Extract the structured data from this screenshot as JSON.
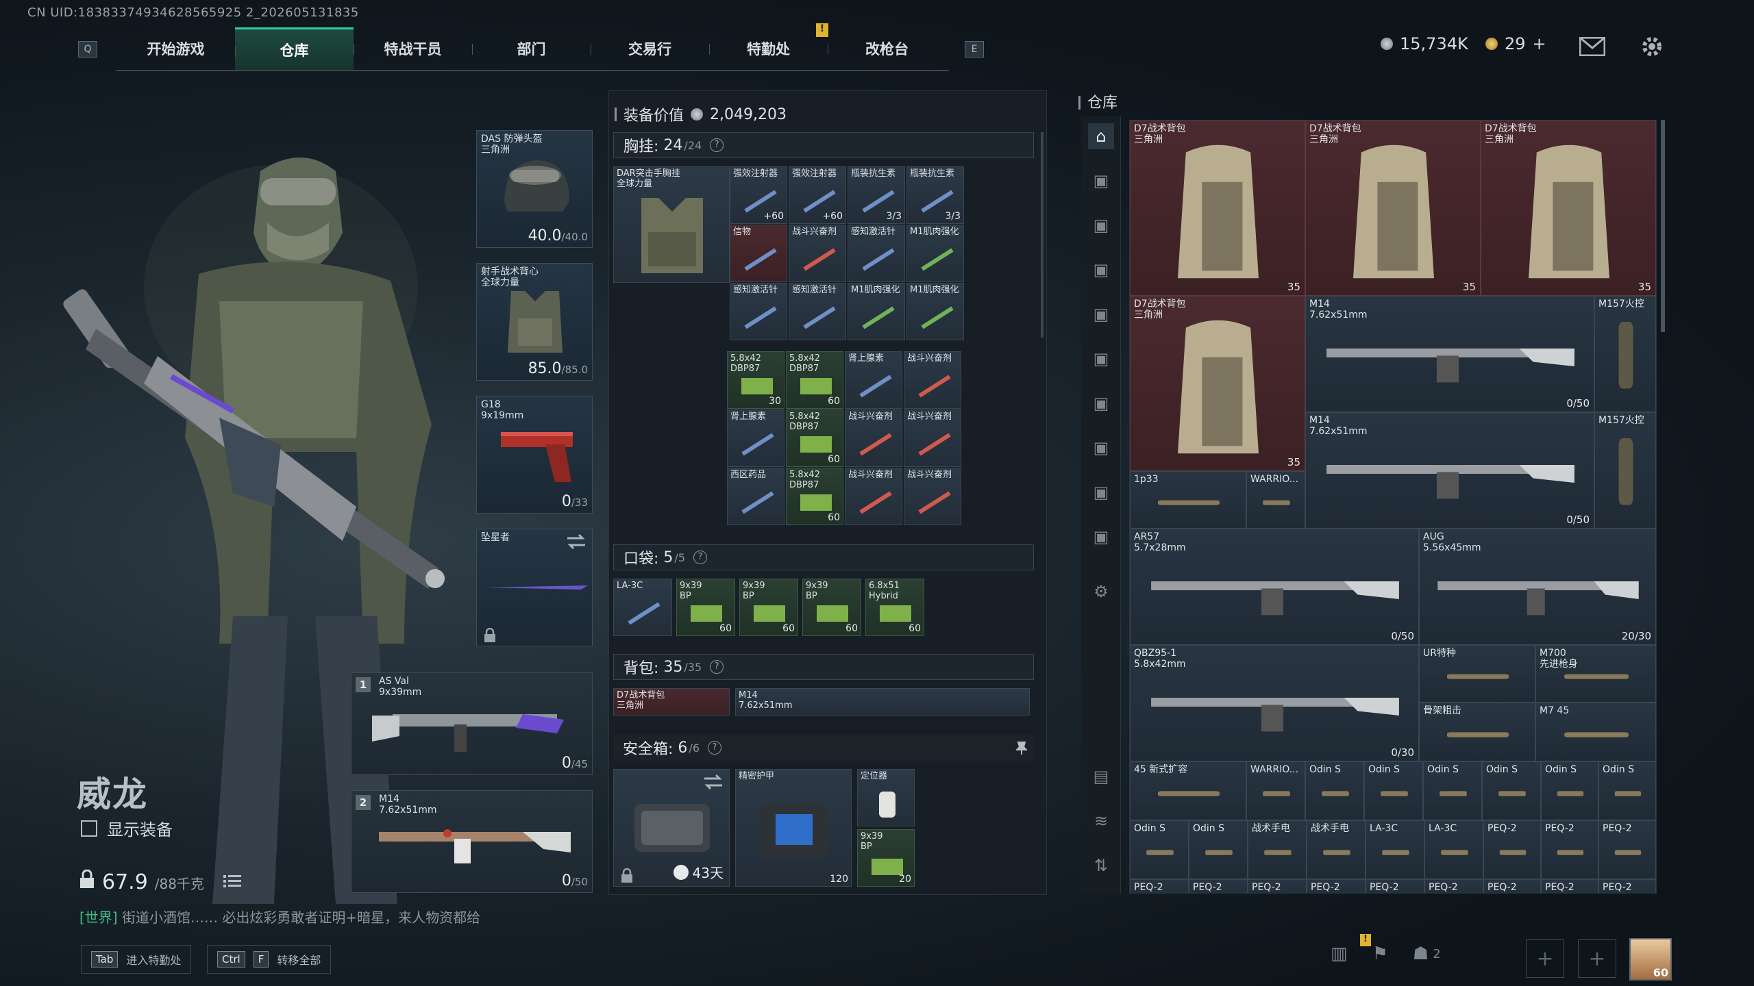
{
  "uid": "CN UID:18383374934628565925 2_202605131835",
  "nav": {
    "key_left": "Q",
    "key_right": "E",
    "tabs": [
      "开始游戏",
      "仓库",
      "特战干员",
      "部门",
      "交易行",
      "特勤处",
      "改枪台"
    ],
    "alert": "!"
  },
  "top": {
    "currency1": "15,734K",
    "currency2": "29",
    "plus": "+"
  },
  "character": {
    "name": "威龙",
    "show_gear": "显示装备",
    "weight": "67.9",
    "weight_max": "/88千克"
  },
  "chat": {
    "channel": "[世界]",
    "text": " 街道小酒馆…… 必出炫彩勇敢者证明+暗星，来人物资都给"
  },
  "hints": [
    {
      "keys": [
        "Tab"
      ],
      "label": "进入特勤处"
    },
    {
      "keys": [
        "Ctrl",
        "F"
      ],
      "label": "转移全部"
    }
  ],
  "gear": {
    "helmet": {
      "label": "DAS 防弹头盔\n三角洲",
      "value": "40.0",
      "max": "/40.0"
    },
    "armor": {
      "label": "射手战术背心\n全球力量",
      "value": "85.0",
      "max": "/85.0"
    },
    "pistol": {
      "label": "G18\n9x19mm",
      "value": "0",
      "max": "/33"
    },
    "melee": {
      "label": "坠星者"
    },
    "primary1": {
      "num": "1",
      "label": "AS Val\n9x39mm",
      "value": "0",
      "max": "/45"
    },
    "primary2": {
      "num": "2",
      "label": "M14\n7.62x51mm",
      "value": "0",
      "max": "/50"
    }
  },
  "equipment": {
    "value_label": "装备价值",
    "value": "2,049,203",
    "chest": {
      "label": "胸挂:",
      "count": "24",
      "max": "/24",
      "rig": "DAR突击手胸挂\n全球力量",
      "items": [
        {
          "l": "强效注射器",
          "c": "+60"
        },
        {
          "l": "强效注射器",
          "c": "+60"
        },
        {
          "l": "瓶装抗生素",
          "c": "3/3"
        },
        {
          "l": "瓶装抗生素",
          "c": "3/3"
        },
        {
          "l": "信物",
          "c": ""
        },
        {
          "l": "战斗兴奋剂",
          "c": ""
        },
        {
          "l": "感知激活针",
          "c": ""
        },
        {
          "l": "M1肌肉强化",
          "c": ""
        },
        {
          "l": "",
          "c": ""
        },
        {
          "l": "感知激活针",
          "c": ""
        },
        {
          "l": "感知激活针",
          "c": ""
        },
        {
          "l": "M1肌肉强化",
          "c": ""
        },
        {
          "l": "M1肌肉强化",
          "c": ""
        },
        {
          "l": "5.8x42\nDBP87",
          "c": "30"
        },
        {
          "l": "5.8x42\nDBP87",
          "c": "60"
        },
        {
          "l": "肾上腺素",
          "c": ""
        },
        {
          "l": "战斗兴奋剂",
          "c": ""
        },
        {
          "l": "肾上腺素",
          "c": ""
        },
        {
          "l": "5.8x42\nDBP87",
          "c": "60"
        },
        {
          "l": "战斗兴奋剂",
          "c": ""
        },
        {
          "l": "战斗兴奋剂",
          "c": ""
        },
        {
          "l": "西区药品",
          "c": ""
        },
        {
          "l": "5.8x42\nDBP87",
          "c": "60"
        },
        {
          "l": "战斗兴奋剂",
          "c": ""
        },
        {
          "l": "战斗兴奋剂",
          "c": ""
        }
      ]
    },
    "pocket": {
      "label": "口袋:",
      "count": "5",
      "max": "/5",
      "items": [
        {
          "l": "LA-3C",
          "c": ""
        },
        {
          "l": "9x39\nBP",
          "c": "60"
        },
        {
          "l": "9x39\nBP",
          "c": "60"
        },
        {
          "l": "9x39\nBP",
          "c": "60"
        },
        {
          "l": "6.8x51\nHybrid",
          "c": "60"
        }
      ]
    },
    "backpack": {
      "label": "背包:",
      "count": "35",
      "max": "/35",
      "items": [
        {
          "l": "D7战术背包\n三角洲"
        },
        {
          "l": "M14\n7.62x51mm"
        }
      ]
    },
    "safebox": {
      "label": "安全箱:",
      "count": "6",
      "max": "/6",
      "days": "43天",
      "items": [
        {
          "l": "精密护甲",
          "c": "120"
        },
        {
          "l": "定位器",
          "c": ""
        },
        {
          "l": "9x39\nBP",
          "c": "20"
        }
      ]
    }
  },
  "warehouse": {
    "title": "仓库",
    "items": [
      {
        "l": "D7战术背包\n三角洲",
        "c": "35"
      },
      {
        "l": "D7战术背包\n三角洲",
        "c": "35"
      },
      {
        "l": "D7战术背包\n三角洲",
        "c": "35"
      },
      {
        "l": "D7战术背包\n三角洲",
        "c": "35"
      },
      {
        "l": "M14\n7.62x51mm",
        "c": "0/50"
      },
      {
        "l": "M157火控",
        "c": ""
      },
      {
        "l": "M14\n7.62x51mm",
        "c": "0/50"
      },
      {
        "l": "M157火控",
        "c": ""
      },
      {
        "l": "1p33",
        "c": ""
      },
      {
        "l": "WARRIO...",
        "c": ""
      },
      {
        "l": "AR57\n5.7x28mm",
        "c": "0/50"
      },
      {
        "l": "AUG\n5.56x45mm",
        "c": "20/30"
      },
      {
        "l": "QBZ95-1\n5.8x42mm",
        "c": "0/30"
      },
      {
        "l": "UR特种",
        "c": ""
      },
      {
        "l": "M700\n先进枪身",
        "c": ""
      },
      {
        "l": "骨架粗击",
        "c": ""
      },
      {
        "l": "M7 45",
        "c": ""
      },
      {
        "l": "45 新式扩容",
        "c": ""
      },
      {
        "l": "WARRIO...",
        "c": ""
      },
      {
        "l": "Odin S",
        "c": ""
      },
      {
        "l": "Odin S",
        "c": ""
      },
      {
        "l": "Odin S",
        "c": ""
      },
      {
        "l": "Odin S",
        "c": ""
      },
      {
        "l": "Odin S",
        "c": ""
      },
      {
        "l": "Odin S",
        "c": ""
      },
      {
        "l": "Odin S",
        "c": ""
      },
      {
        "l": "Odin S",
        "c": ""
      },
      {
        "l": "战术手电",
        "c": ""
      },
      {
        "l": "战术手电",
        "c": ""
      },
      {
        "l": "LA-3C",
        "c": ""
      },
      {
        "l": "LA-3C",
        "c": ""
      },
      {
        "l": "PEQ-2",
        "c": ""
      },
      {
        "l": "PEQ-2",
        "c": ""
      },
      {
        "l": "PEQ-2",
        "c": ""
      },
      {
        "l": "PEQ-2",
        "c": ""
      },
      {
        "l": "PEQ-2",
        "c": ""
      },
      {
        "l": "PEQ-2",
        "c": ""
      },
      {
        "l": "PEQ-2",
        "c": ""
      },
      {
        "l": "PEQ-2",
        "c": ""
      },
      {
        "l": "PEQ-2",
        "c": ""
      },
      {
        "l": "PEQ-2",
        "c": ""
      },
      {
        "l": "PEQ-2",
        "c": ""
      },
      {
        "l": "PEQ-2",
        "c": ""
      }
    ]
  },
  "bottom": {
    "squad": "2",
    "alert": "!",
    "avatar_level": "60"
  },
  "colors": {
    "accent": "#2fd29b",
    "red_slot": "#4a2a2e",
    "green_slot": "#2b3f33"
  }
}
